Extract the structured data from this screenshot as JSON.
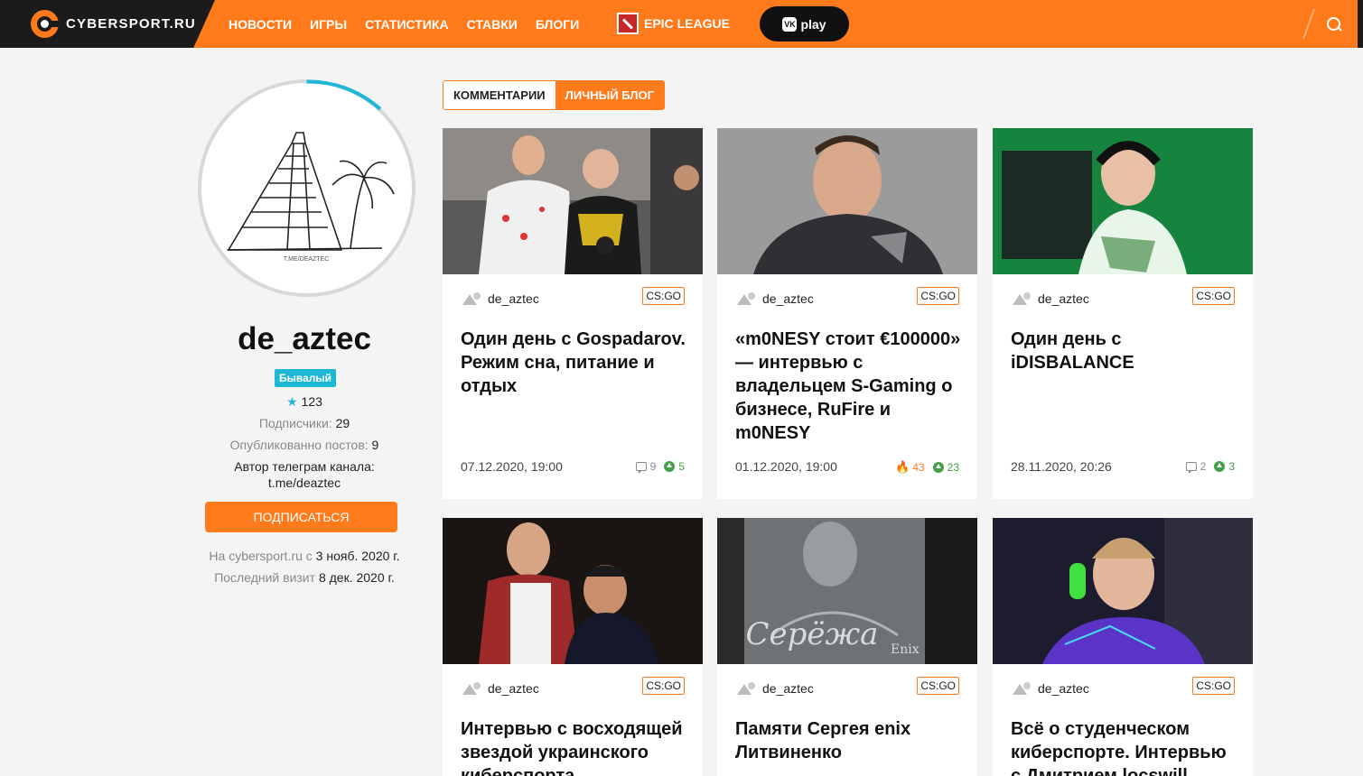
{
  "header": {
    "logo_text": "CYBERSPORT.RU",
    "nav": [
      "НОВОСТИ",
      "ИГРЫ",
      "СТАТИСТИКА",
      "СТАВКИ",
      "БЛОГИ"
    ],
    "epic_label": "EPIC LEAGUE",
    "vkplay_label": "play",
    "vk_icon_text": "VK"
  },
  "profile": {
    "avatar_caption": "T.ME/DEAZTEC",
    "username": "de_aztec",
    "rank": "Бывалый",
    "rating": "123",
    "subscribers_label": "Подписчики:",
    "subscribers_value": "29",
    "posts_label": "Опубликованно постов:",
    "posts_value": "9",
    "telegram_line1": "Автор телеграм канала:",
    "telegram_line2": "t.me/deaztec",
    "subscribe_label": "ПОДПИСАТЬСЯ",
    "since_label": "На cybersport.ru с",
    "since_value": "3 нояб. 2020 г.",
    "visit_label": "Последний визит",
    "visit_value": "8 дек. 2020 г."
  },
  "tabs": [
    {
      "label": "КОММЕНТАРИИ",
      "active": false
    },
    {
      "label": "ЛИЧНЫЙ БЛОГ",
      "active": true
    }
  ],
  "posts": [
    {
      "author": "de_aztec",
      "game": "CS:GO",
      "title": "Один день с Gospadarov. Режим сна, питание и отдых",
      "date": "07.12.2020, 19:00",
      "comments": "9",
      "hot": "",
      "rating": "5"
    },
    {
      "author": "de_aztec",
      "game": "CS:GO",
      "title": "«m0NESY стоит €100000» — интервью с владельцем S-Gaming о бизнесе, RuFire и m0NESY",
      "date": "01.12.2020, 19:00",
      "comments": "",
      "hot": "43",
      "rating": "23"
    },
    {
      "author": "de_aztec",
      "game": "CS:GO",
      "title": "Один день с iDISBALANCE",
      "date": "28.11.2020, 20:26",
      "comments": "2",
      "hot": "",
      "rating": "3"
    },
    {
      "author": "de_aztec",
      "game": "CS:GO",
      "title": "Интервью с восходящей звездой украинского киберспорта",
      "date": "",
      "comments": "",
      "hot": "",
      "rating": ""
    },
    {
      "author": "de_aztec",
      "game": "CS:GO",
      "title": "Памяти Сергея enix Литвиненко",
      "image_text": "Серёжа",
      "image_subtext": "Enix",
      "date": "",
      "comments": "",
      "hot": "",
      "rating": ""
    },
    {
      "author": "de_aztec",
      "game": "CS:GO",
      "title": "Всё о студенческом киберспорте. Интервью с Дмитрием loсswill",
      "date": "",
      "comments": "",
      "hot": "",
      "rating": ""
    }
  ]
}
